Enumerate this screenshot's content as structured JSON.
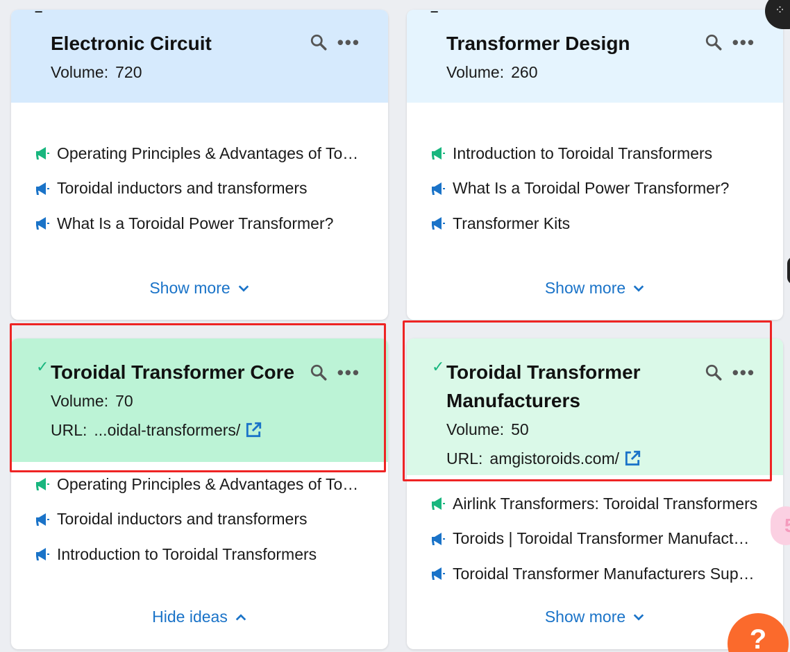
{
  "cards": [
    {
      "title": "Electronic Circuit",
      "status": "dash",
      "volume_label": "Volume:",
      "volume": "720",
      "ideas": [
        {
          "text": "Operating Principles & Advantages of Toroidal Transformers",
          "icon": "megaphone-icon",
          "color": "#18b67e"
        },
        {
          "text": "Toroidal inductors and transformers",
          "icon": "megaphone-icon",
          "color": "#1a73c8"
        },
        {
          "text": "What Is a Toroidal Power Transformer?",
          "icon": "megaphone-icon",
          "color": "#1a73c8"
        }
      ],
      "toggle_label": "Show more"
    },
    {
      "title": "Transformer Design",
      "status": "dash",
      "volume_label": "Volume:",
      "volume": "260",
      "ideas": [
        {
          "text": "Introduction to Toroidal Transformers",
          "icon": "megaphone-icon",
          "color": "#18b67e"
        },
        {
          "text": "What Is a Toroidal Power Transformer?",
          "icon": "megaphone-icon",
          "color": "#1a73c8"
        },
        {
          "text": "Transformer Kits",
          "icon": "megaphone-icon",
          "color": "#1a73c8"
        }
      ],
      "toggle_label": "Show more"
    },
    {
      "title": "Toroidal Transformer Core",
      "status": "check",
      "volume_label": "Volume:",
      "volume": "70",
      "url_label": "URL:",
      "url": "...oidal-transformers/",
      "ideas": [
        {
          "text": "Operating Principles & Advantages of Toroidal Transformers",
          "icon": "megaphone-icon",
          "color": "#18b67e"
        },
        {
          "text": "Toroidal inductors and transformers",
          "icon": "megaphone-icon",
          "color": "#1a73c8"
        },
        {
          "text": "Introduction to Toroidal Transformers",
          "icon": "megaphone-icon",
          "color": "#1a73c8"
        }
      ],
      "toggle_label": "Hide ideas"
    },
    {
      "title_line1": "Toroidal Transformer",
      "title_line2": "Manufacturers",
      "status": "check",
      "volume_label": "Volume:",
      "volume": "50",
      "url_label": "URL:",
      "url": "amgistoroids.com/",
      "ideas": [
        {
          "text": "Airlink Transformers: Toroidal Transformers",
          "icon": "megaphone-icon",
          "color": "#18b67e"
        },
        {
          "text": "Toroids | Toroidal Transformer Manufacturers",
          "icon": "megaphone-icon",
          "color": "#1a73c8"
        },
        {
          "text": "Toroidal Transformer Manufacturers Suppliers",
          "icon": "megaphone-icon",
          "color": "#1a73c8"
        }
      ],
      "toggle_label": "Show more"
    }
  ],
  "colors": {
    "head_blue": "#d6eafd",
    "head_lightblue": "#e5f4fe",
    "head_green": "#bcf3d6",
    "head_lightgreen": "#daf9e8",
    "link_blue": "#1a73c8",
    "highlight_red": "#ee2424",
    "help_orange": "#fb6a2c"
  },
  "help_button_label": "?",
  "pink_widget_label": "5"
}
